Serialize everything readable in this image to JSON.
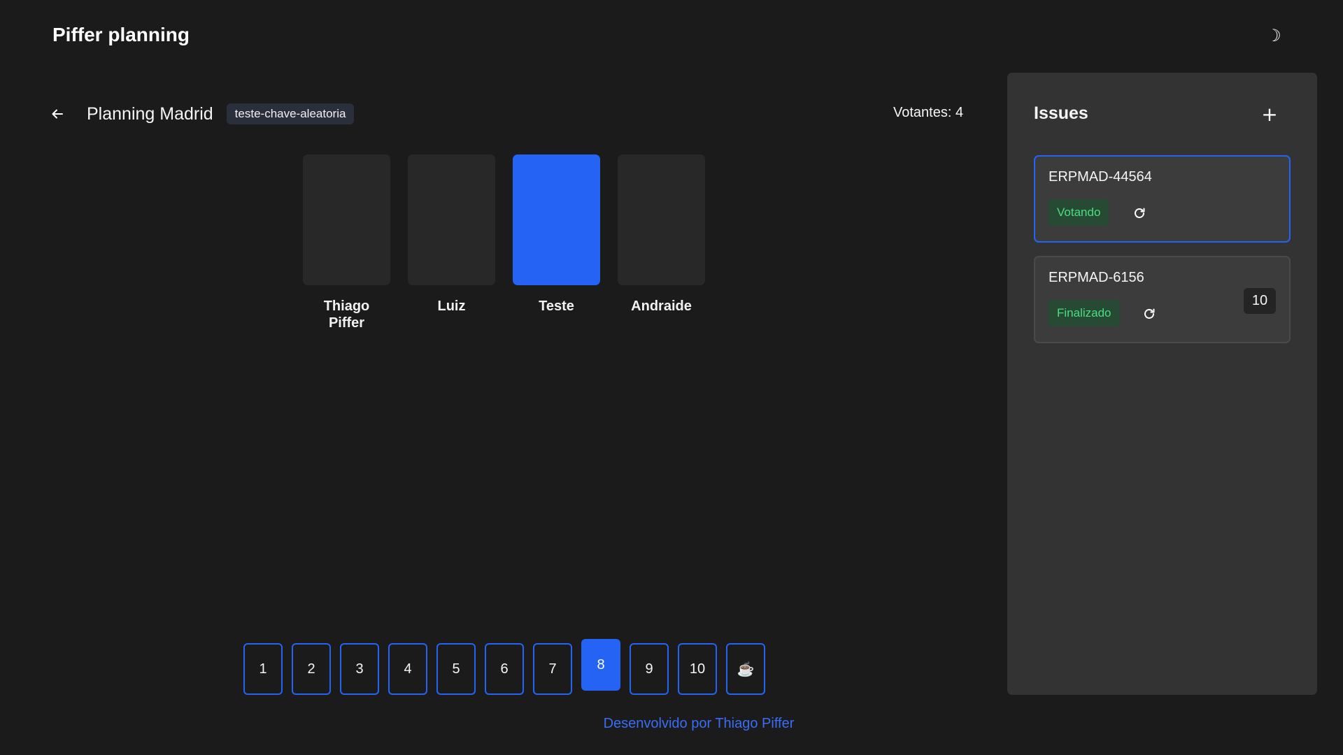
{
  "app": {
    "title": "Piffer planning",
    "theme_icon": "☽"
  },
  "room": {
    "name": "Planning Madrid",
    "key": "teste-chave-aleatoria",
    "voters_label": "Votantes: 4"
  },
  "players": [
    {
      "name": "Thiago Piffer",
      "voted": false
    },
    {
      "name": "Luiz",
      "voted": false
    },
    {
      "name": "Teste",
      "voted": true
    },
    {
      "name": "Andraide",
      "voted": false
    }
  ],
  "deck": {
    "cards": [
      "1",
      "2",
      "3",
      "4",
      "5",
      "6",
      "7",
      "8",
      "9",
      "10",
      "☕"
    ],
    "selected": "8"
  },
  "footer": {
    "credit": "Desenvolvido por Thiago Piffer"
  },
  "issues": {
    "title": "Issues",
    "add_label": "+",
    "items": [
      {
        "key": "ERPMAD-44564",
        "status": "Votando",
        "score": "",
        "active": true
      },
      {
        "key": "ERPMAD-6156",
        "status": "Finalizado",
        "score": "10",
        "active": false
      }
    ]
  },
  "colors": {
    "accent": "#2563f5",
    "background": "#1b1b1c",
    "panel": "#333333",
    "status_text": "#4ade80",
    "status_bg": "#264a33"
  }
}
